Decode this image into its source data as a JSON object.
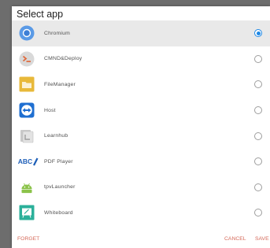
{
  "dialog": {
    "title": "Select app",
    "apps": [
      {
        "label": "Chromium",
        "icon": "chromium-icon",
        "selected": true
      },
      {
        "label": "CMND&Deploy",
        "icon": "terminal-icon",
        "selected": false
      },
      {
        "label": "FileManager",
        "icon": "folder-icon",
        "selected": false
      },
      {
        "label": "Host",
        "icon": "teamviewer-icon",
        "selected": false
      },
      {
        "label": "Learnhub",
        "icon": "learnhub-icon",
        "selected": false
      },
      {
        "label": "PDF Player",
        "icon": "pdf-player-icon",
        "icon_text": "ABC",
        "selected": false
      },
      {
        "label": "tpvLauncher",
        "icon": "android-icon",
        "selected": false
      },
      {
        "label": "Whiteboard",
        "icon": "whiteboard-icon",
        "selected": false
      }
    ],
    "actions": {
      "forget": "FORGET",
      "cancel": "CANCEL",
      "save": "SAVE"
    }
  },
  "colors": {
    "accent": "#1e88e5",
    "action_text": "#d56a5a",
    "selected_row": "#e9e9e9"
  }
}
